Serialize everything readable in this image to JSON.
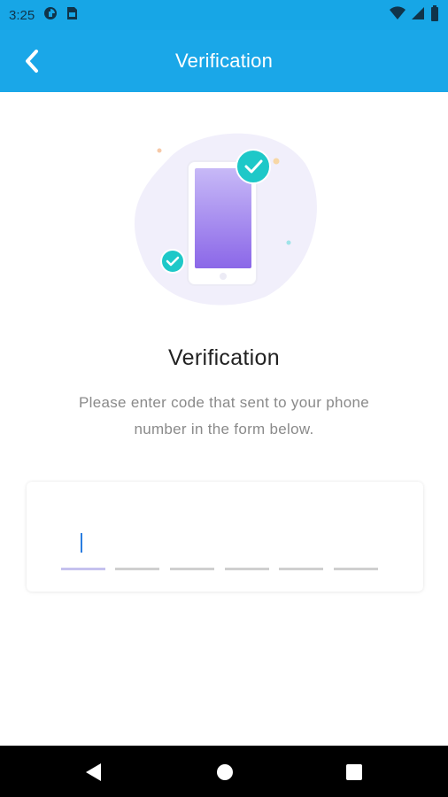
{
  "status_bar": {
    "time": "3:25",
    "left_icons": [
      "data-saver-icon",
      "sim-card-icon"
    ],
    "right_icons": [
      "wifi-icon",
      "signal-icon",
      "battery-icon"
    ]
  },
  "app_bar": {
    "title": "Verification",
    "back_icon": "chevron-left-icon",
    "color": "#1aa7e8"
  },
  "illustration": {
    "icons": [
      "phone-icon",
      "check-circle-icon",
      "check-circle-icon"
    ],
    "accent": "#1ec8c8",
    "phone_gradient": [
      "#c7b9f7",
      "#8b67e8"
    ]
  },
  "content": {
    "heading": "Verification",
    "description_line1": "Please enter code that sent to your phone",
    "description_line2": "number in the form below."
  },
  "code_input": {
    "digits": [
      "",
      "",
      "",
      "",
      "",
      ""
    ],
    "active_index": 0
  },
  "nav_bar": {
    "buttons": [
      "back-triangle-icon",
      "home-circle-icon",
      "recents-square-icon"
    ]
  }
}
